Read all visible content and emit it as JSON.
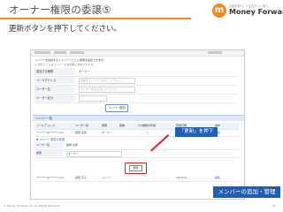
{
  "slide": {
    "title": "オーナー権限の委譲⑤",
    "subtitle": "更新ボタンを押下してください。",
    "callout": "「更新」を押下",
    "badge": "メンバーの追加・管理",
    "copyright": "© Money Forward, Inc. All Rights Reserved",
    "page_number": "15"
  },
  "brand": {
    "mark": "m",
    "tagline": "お金を前へ。人生をもっと前へ。",
    "name": "Money Forward",
    "accent_color": "#f08a24",
    "blue_color": "#1e60b6"
  },
  "screen": {
    "header_line1": "メンバーを追加するとメンバーごとに権限を設定できます。",
    "header_line2": "※ 招待メールはメンバーの追加時に送信されます。",
    "form": {
      "rows": [
        {
          "label": "追加する権限",
          "value": "オーナー"
        },
        {
          "label": "メールアドレス",
          "placeholder": "追加するメンバーのメールアドレス"
        },
        {
          "label": "ユーザー名",
          "placeholder": "ユーザー名を入力してください"
        },
        {
          "label": "ユーザー区分"
        }
      ],
      "add_button": "メンバー追加"
    },
    "section_title": "メンバー一覧",
    "table_headers": [
      "メールアドレス",
      "ユーザー名",
      "権限",
      "部署",
      "プロ機能を利用",
      "登録日時",
      "操作"
    ],
    "table_rows": [
      [
        "********@******.com",
        "開発 太郎",
        "オーナー",
        "",
        "○",
        "2015/01",
        "編集"
      ]
    ],
    "edit_title": "▼ メンバー設定の変更",
    "edit_rows": [
      {
        "label": "ユーザー名",
        "value": "開発 太郎"
      },
      {
        "label": "権限",
        "value": "オーナー"
      }
    ],
    "update_button": "更新",
    "table2_rows": [
      [
        "********@******.com",
        "開発 花子",
        "メンバー",
        "",
        "",
        "2015/01",
        "編集"
      ]
    ]
  }
}
